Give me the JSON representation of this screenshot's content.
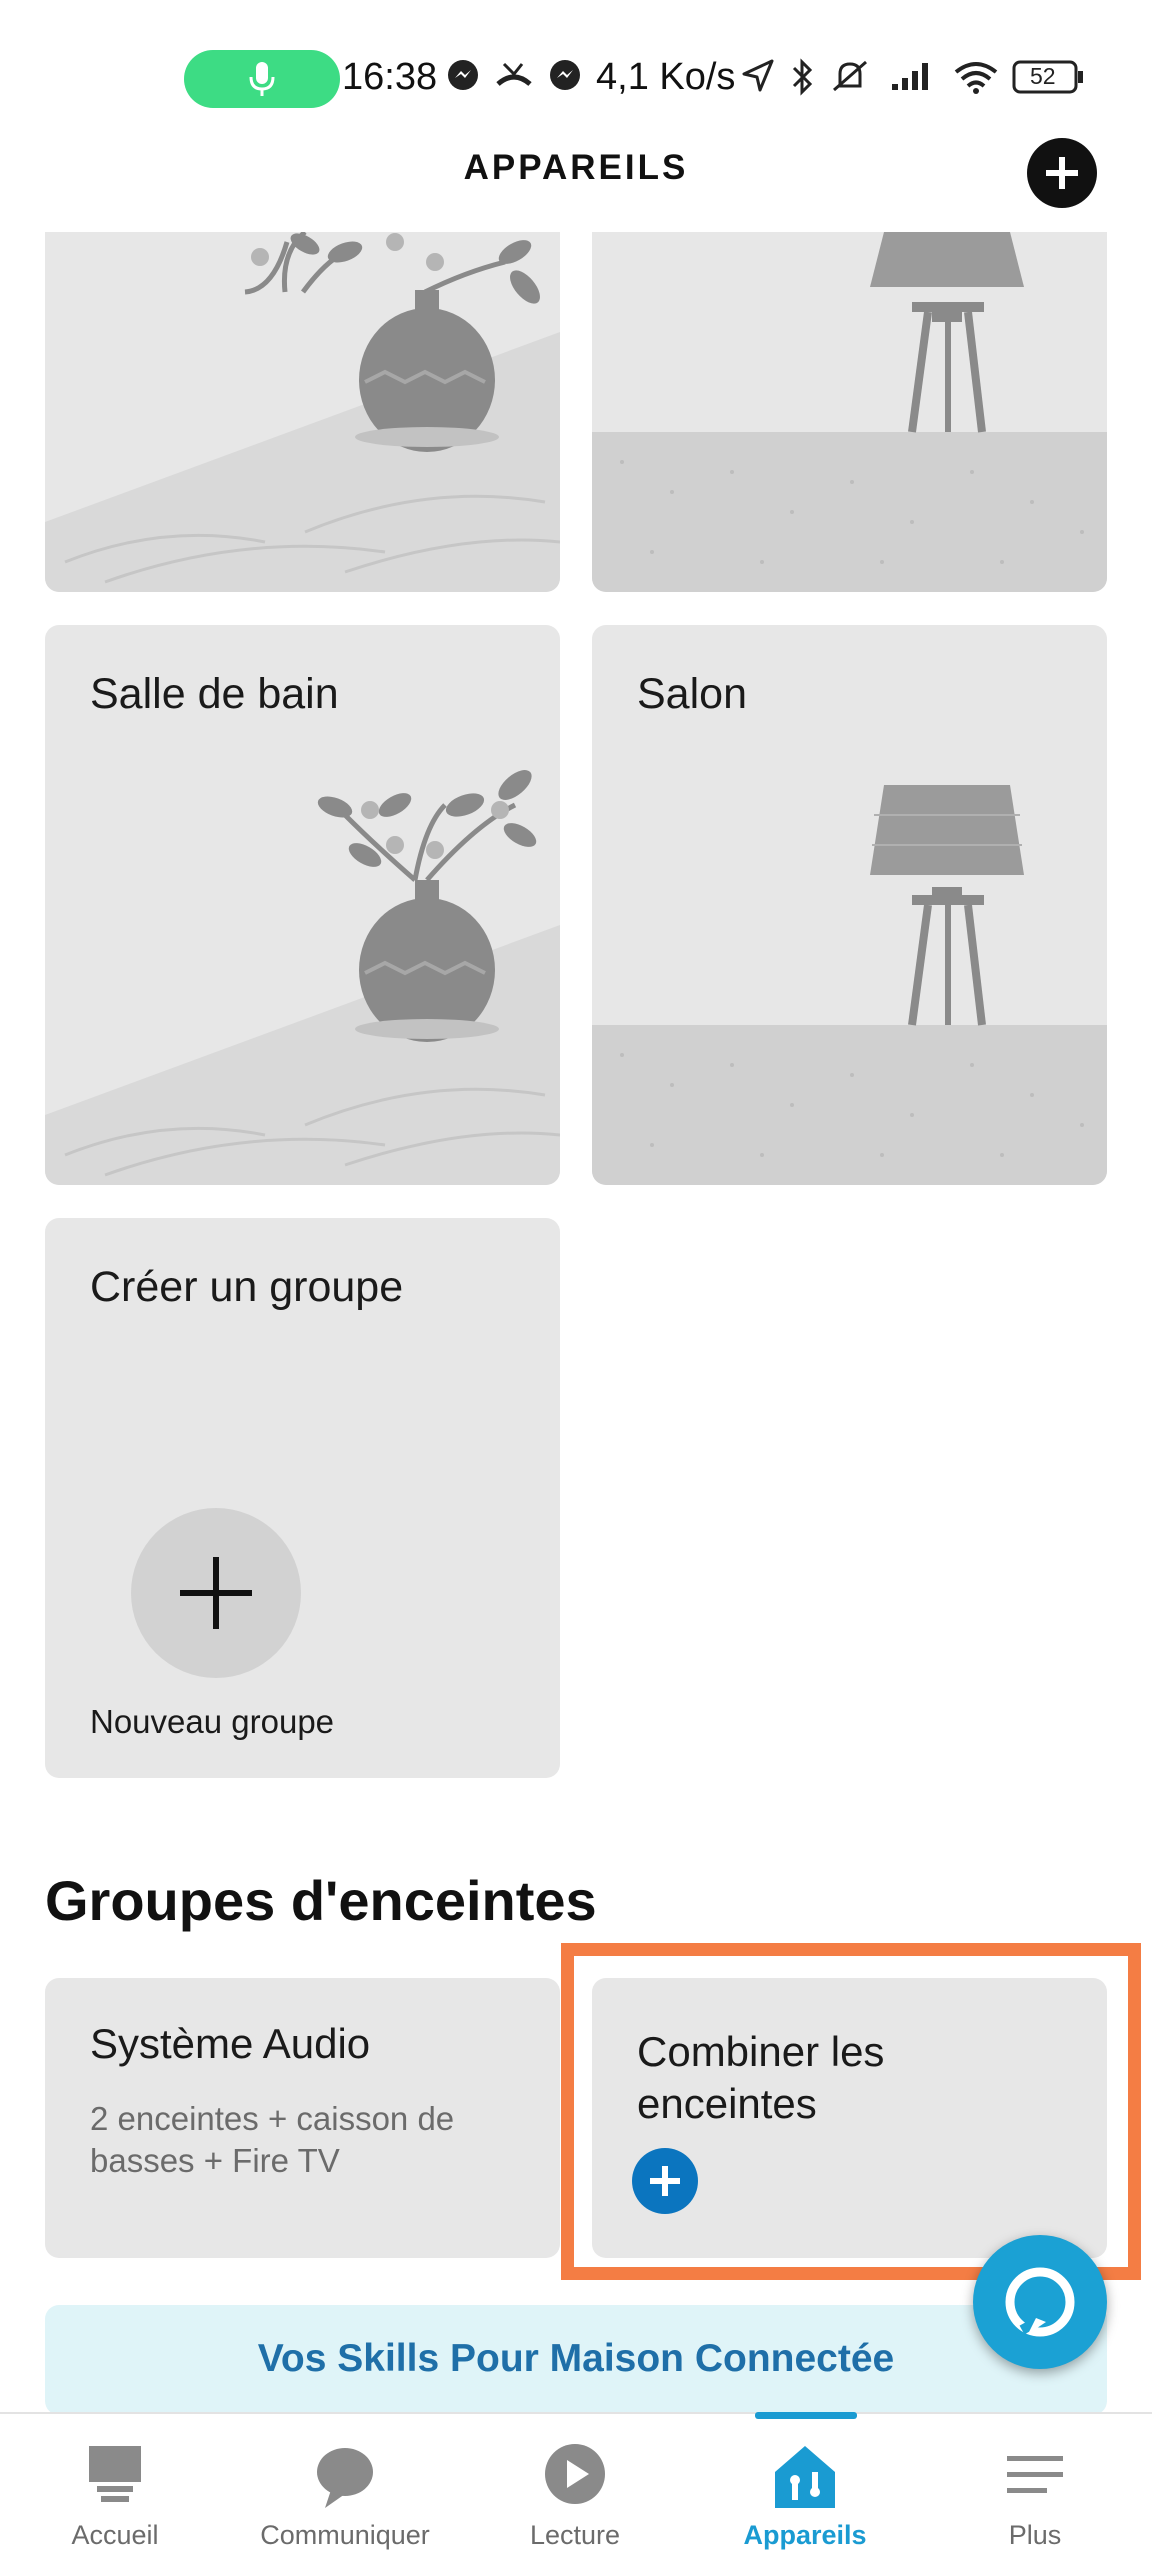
{
  "status_bar": {
    "time": "16:38",
    "network_speed": "4,1 Ko/s",
    "battery": "52"
  },
  "header": {
    "title": "APPAREILS"
  },
  "groups": {
    "tiles": [
      {
        "label": ""
      },
      {
        "label": ""
      },
      {
        "label": "Salle de bain"
      },
      {
        "label": "Salon"
      }
    ],
    "create_group": {
      "label": "Créer un groupe",
      "button_label": "Nouveau groupe"
    }
  },
  "speaker_groups": {
    "title": "Groupes d'enceintes",
    "audio_system": {
      "name": "Système Audio",
      "details": "2 enceintes  + caisson de basses  + Fire TV"
    },
    "combine": {
      "label": "Combiner les enceintes"
    }
  },
  "skills_banner": {
    "label": "Vos Skills Pour Maison Connectée"
  },
  "bottom_nav": {
    "items": [
      {
        "label": "Accueil",
        "icon": "home-icon"
      },
      {
        "label": "Communiquer",
        "icon": "chat-icon"
      },
      {
        "label": "Lecture",
        "icon": "play-icon"
      },
      {
        "label": "Appareils",
        "icon": "devices-icon",
        "active": true
      },
      {
        "label": "Plus",
        "icon": "menu-icon"
      }
    ]
  },
  "colors": {
    "accent": "#1a9bd2",
    "highlight": "#f47d44",
    "tile_bg": "#e7e7e7",
    "plus_blue": "#0b75bf"
  }
}
